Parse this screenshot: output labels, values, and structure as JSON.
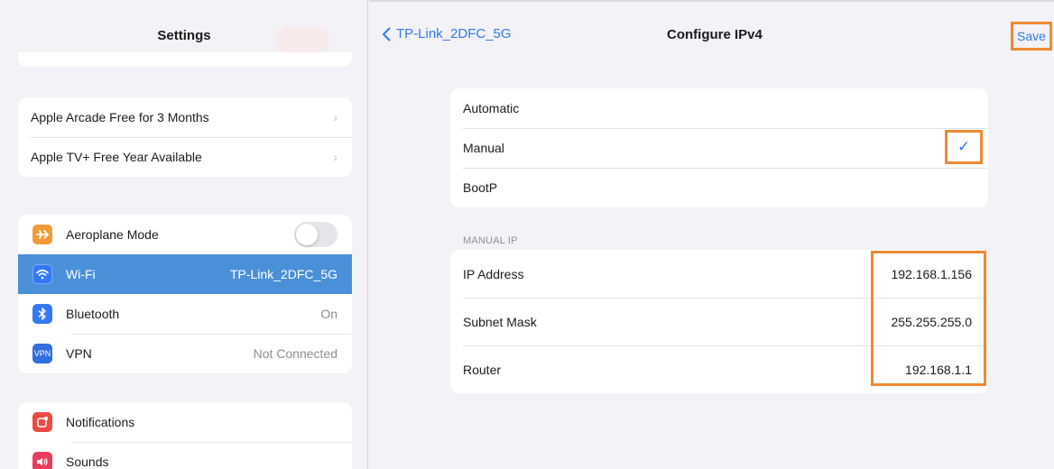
{
  "sidebar": {
    "title": "Settings",
    "promos": [
      {
        "label": "Apple Arcade Free for 3 Months"
      },
      {
        "label": "Apple TV+ Free Year Available"
      }
    ],
    "connectivity": [
      {
        "label": "Aeroplane Mode",
        "value": "",
        "icon": "airplane-icon",
        "color": "#f19a37"
      },
      {
        "label": "Wi-Fi",
        "value": "TP-Link_2DFC_5G",
        "icon": "wifi-icon",
        "color": "#3478f6"
      },
      {
        "label": "Bluetooth",
        "value": "On",
        "icon": "bluetooth-icon",
        "color": "#3478f6"
      },
      {
        "label": "VPN",
        "value": "Not Connected",
        "icon": "vpn-icon",
        "icon_text": "VPN",
        "color": "#2f6fe0"
      }
    ],
    "system": [
      {
        "label": "Notifications",
        "icon": "notifications-icon",
        "color": "#ee4a43"
      },
      {
        "label": "Sounds",
        "icon": "sounds-icon",
        "color": "#ea3c5e"
      }
    ]
  },
  "header": {
    "back_label": "TP-Link_2DFC_5G",
    "title": "Configure IPv4",
    "save_label": "Save"
  },
  "configure": {
    "options": [
      {
        "label": "Automatic"
      },
      {
        "label": "Manual",
        "selected": true
      },
      {
        "label": "BootP"
      }
    ],
    "check_glyph": "✓"
  },
  "manual_ip": {
    "section_label": "MANUAL IP",
    "fields": [
      {
        "label": "IP Address",
        "value": "192.168.1.156"
      },
      {
        "label": "Subnet Mask",
        "value": "255.255.255.0"
      },
      {
        "label": "Router",
        "value": "192.168.1.1"
      }
    ]
  },
  "colors": {
    "accent": "#3478f6",
    "highlight": "#ef8a33",
    "selected_row": "#4a90d9"
  }
}
